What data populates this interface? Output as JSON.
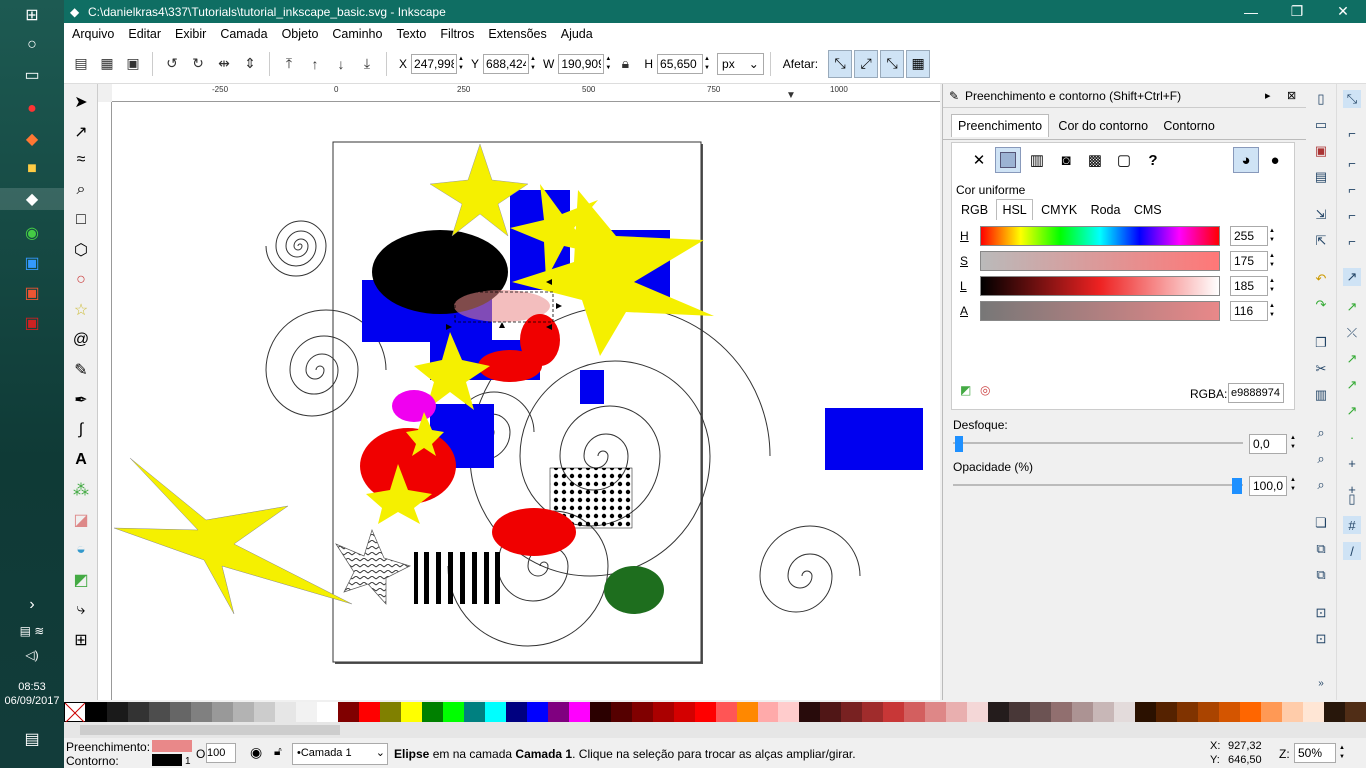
{
  "window": {
    "title": "C:\\danielkras4\\337\\Tutorials\\tutorial_inkscape_basic.svg - Inkscape",
    "minimize": "—",
    "restore": "❐",
    "close": "✕"
  },
  "taskbar": {
    "time": "08:53",
    "date": "06/09/2017"
  },
  "menu": [
    "Arquivo",
    "Editar",
    "Exibir",
    "Camada",
    "Objeto",
    "Caminho",
    "Texto",
    "Filtros",
    "Extensões",
    "Ajuda"
  ],
  "toolbar": {
    "x_label": "X",
    "x": "247,998",
    "y_label": "Y",
    "y": "688,424",
    "w_label": "W",
    "w": "190,909",
    "h_label": "H",
    "h": "65,650",
    "unit": "px",
    "affect_label": "Afetar:"
  },
  "ruler": {
    "h": [
      "-250",
      "0",
      "250",
      "500",
      "750",
      "1000"
    ]
  },
  "panel": {
    "title": "Preenchimento e contorno (Shift+Ctrl+F)",
    "tabs": [
      "Preenchimento",
      "Cor do contorno",
      "Contorno"
    ],
    "flat_label": "Cor uniforme",
    "color_tabs": [
      "RGB",
      "HSL",
      "CMYK",
      "Roda",
      "CMS"
    ],
    "sliders": [
      {
        "label": "H",
        "value": "255"
      },
      {
        "label": "S",
        "value": "175"
      },
      {
        "label": "L",
        "value": "185"
      },
      {
        "label": "A",
        "value": "116"
      }
    ],
    "rgba_label": "RGBA:",
    "rgba": "e9888974",
    "blur_label": "Desfoque:",
    "blur": "0,0",
    "opacity_label": "Opacidade (%)",
    "opacity": "100,0"
  },
  "status": {
    "fill_label": "Preenchimento:",
    "stroke_label": "Contorno:",
    "opacity_label": "O:",
    "opacity": "100",
    "layer": "•Camada 1",
    "msg_bold": "Elipse",
    "msg1": " em na camada ",
    "msg_layer": "Camada 1",
    "msg2": ". Clique na seleção para trocar as alças ampliar/girar.",
    "stroke_width": "1",
    "x_label": "X:",
    "x": "927,32",
    "y_label": "Y:",
    "y": "646,50",
    "zoom_label": "Z:",
    "zoom": "50%"
  },
  "colors": {
    "accent": "#0f6e63",
    "fill": "#e98889"
  }
}
